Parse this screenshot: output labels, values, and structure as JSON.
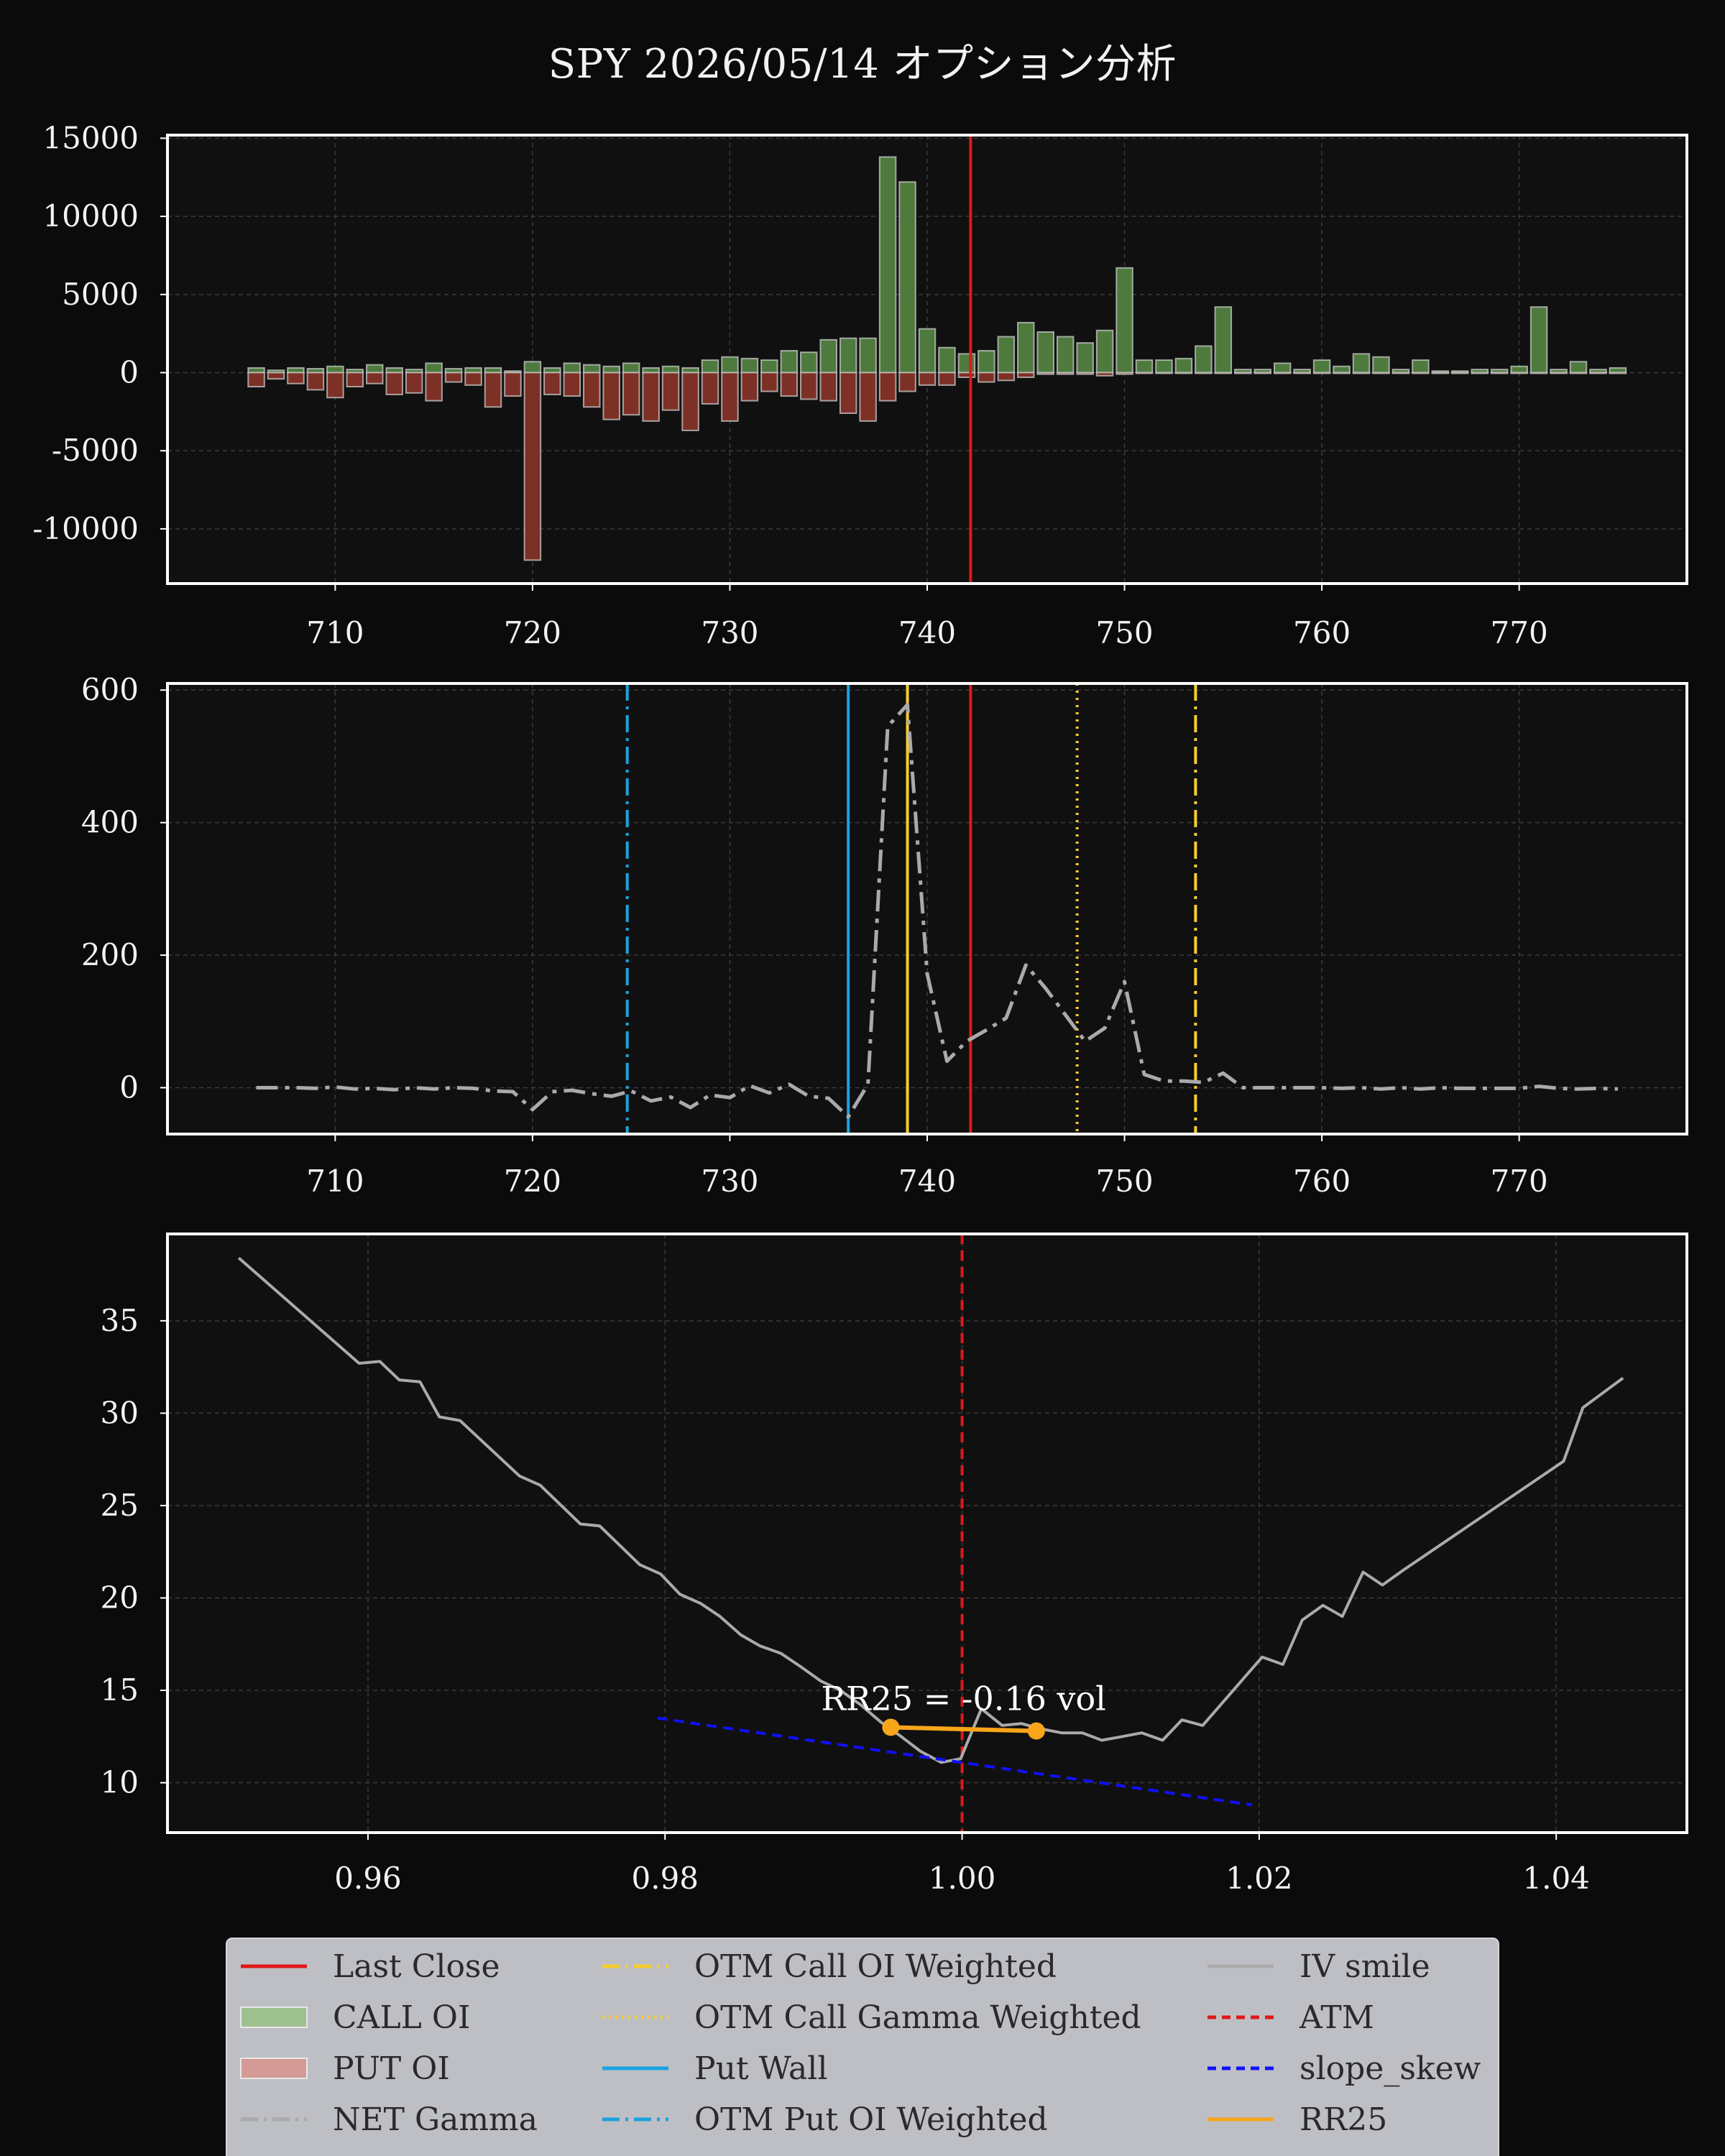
{
  "title": "SPY 2026/05/14 オプション分析",
  "colors": {
    "background": "#0b0b0b",
    "axes_bg": "#101010",
    "frame": "#ffffff",
    "grid": "#3a3a3a",
    "call": "#4e7a3e",
    "put": "#7d3026",
    "last_close": "#e01818",
    "gamma": "#aaaaaa",
    "otm_call": "#f7cd2e",
    "put_wall": "#1aa3e0",
    "iv_smile": "#aaaaaa",
    "slope_skew": "#1010ff",
    "rr25": "#f9a51a"
  },
  "chart_data": [
    {
      "type": "bar",
      "name": "oi-panel",
      "title": "",
      "xlabel": "",
      "ylabel": "",
      "xlim": [
        701.5,
        778.5
      ],
      "ylim": [
        -13500,
        15200
      ],
      "xticks": [
        710,
        720,
        730,
        740,
        750,
        760,
        770
      ],
      "yticks": [
        15000,
        10000,
        5000,
        0,
        -5000,
        -10000
      ],
      "grid": true,
      "last_close": 742.2,
      "strikes": [
        706,
        707,
        708,
        709,
        710,
        711,
        712,
        713,
        714,
        715,
        716,
        717,
        718,
        719,
        720,
        721,
        722,
        723,
        724,
        725,
        726,
        727,
        728,
        729,
        730,
        731,
        732,
        733,
        734,
        735,
        736,
        737,
        738,
        739,
        740,
        741,
        742,
        743,
        744,
        745,
        746,
        747,
        748,
        749,
        750,
        751,
        752,
        753,
        754,
        755,
        756,
        757,
        758,
        759,
        760,
        761,
        762,
        763,
        764,
        765,
        766,
        767,
        768,
        769,
        770,
        771,
        772,
        773,
        774,
        775
      ],
      "series": [
        {
          "name": "CALL OI",
          "values": [
            300,
            150,
            300,
            250,
            400,
            200,
            500,
            300,
            200,
            600,
            250,
            300,
            300,
            100,
            700,
            300,
            600,
            500,
            400,
            600,
            300,
            400,
            300,
            800,
            1000,
            900,
            800,
            1400,
            1300,
            2100,
            2200,
            2200,
            13800,
            12200,
            2800,
            1600,
            1200,
            1400,
            2300,
            3200,
            2600,
            2300,
            1900,
            2700,
            6700,
            800,
            800,
            900,
            1700,
            4200,
            200,
            200,
            600,
            200,
            800,
            400,
            1200,
            1000,
            200,
            800,
            100,
            100,
            200,
            200,
            400,
            4200,
            200,
            700,
            200,
            300
          ]
        },
        {
          "name": "PUT OI",
          "values": [
            -900,
            -400,
            -700,
            -1100,
            -1600,
            -900,
            -700,
            -1400,
            -1300,
            -1800,
            -600,
            -800,
            -2200,
            -1500,
            -12000,
            -1400,
            -1500,
            -2200,
            -3000,
            -2700,
            -3100,
            -2400,
            -3700,
            -2000,
            -3100,
            -1800,
            -1200,
            -1500,
            -1700,
            -1800,
            -2600,
            -3100,
            -1800,
            -1200,
            -800,
            -800,
            -300,
            -600,
            -500,
            -300,
            -100,
            -100,
            -100,
            -200,
            -100,
            -50,
            -50,
            -50,
            -50,
            -50,
            -50,
            -50,
            -50,
            -50,
            -50,
            -50,
            -50,
            -50,
            -50,
            -50,
            -50,
            -50,
            -50,
            -50,
            -50,
            -50,
            -50,
            -50,
            -50,
            -50
          ]
        }
      ]
    },
    {
      "type": "line",
      "name": "gamma-panel",
      "title": "",
      "xlabel": "",
      "ylabel": "",
      "xlim": [
        701.5,
        778.5
      ],
      "ylim": [
        -70,
        610
      ],
      "xticks": [
        710,
        720,
        730,
        740,
        750,
        760,
        770
      ],
      "yticks": [
        600,
        400,
        200,
        0
      ],
      "grid": true,
      "series": [
        {
          "name": "NET Gamma",
          "x": [
            706,
            707,
            708,
            709,
            710,
            711,
            712,
            713,
            714,
            715,
            716,
            717,
            718,
            719,
            720,
            721,
            722,
            723,
            724,
            725,
            726,
            727,
            728,
            729,
            730,
            731,
            732,
            733,
            734,
            735,
            736,
            737,
            738,
            739,
            740,
            741,
            742,
            743,
            744,
            745,
            746,
            747,
            748,
            749,
            750,
            751,
            752,
            753,
            754,
            755,
            756,
            757,
            758,
            759,
            760,
            761,
            762,
            763,
            764,
            765,
            766,
            767,
            768,
            769,
            770,
            771,
            772,
            773,
            774,
            775
          ],
          "y": [
            0,
            0,
            0,
            -1,
            1,
            -2,
            -1,
            -3,
            0,
            -2,
            0,
            -1,
            -5,
            -6,
            -33,
            -6,
            -4,
            -9,
            -13,
            -5,
            -20,
            -14,
            -30,
            -11,
            -15,
            3,
            -8,
            5,
            -13,
            -16,
            -44,
            5,
            545,
            578,
            172,
            40,
            70,
            87,
            105,
            185,
            150,
            110,
            70,
            90,
            160,
            20,
            10,
            10,
            8,
            22,
            0,
            0,
            0,
            0,
            0,
            -1,
            0,
            -2,
            0,
            -2,
            0,
            -1,
            -1,
            -1,
            -1,
            2,
            -1,
            -2,
            -1,
            -2
          ]
        }
      ],
      "vlines": [
        {
          "name": "Last Close",
          "x": 742.2
        },
        {
          "name": "OTM Call OI Weighted",
          "x": 753.6
        },
        {
          "name": "OTM Call Gamma Weighted",
          "x": 747.6
        },
        {
          "name": "Put Wall",
          "x": 736
        },
        {
          "name": "OTM Put OI Weighted",
          "x": 724.8
        },
        {
          "name": "",
          "x": 739
        }
      ]
    },
    {
      "type": "line",
      "name": "iv-panel",
      "title": "",
      "xlabel": "",
      "ylabel": "",
      "xlim": [
        0.9465,
        1.0488
      ],
      "ylim": [
        7.3,
        39.7
      ],
      "xticks": [
        0.96,
        0.98,
        1.0,
        1.02,
        1.04
      ],
      "xticklabels": [
        "0.96",
        "0.98",
        "1.00",
        "1.02",
        "1.04"
      ],
      "yticks": [
        35,
        30,
        25,
        20,
        15,
        10
      ],
      "grid": true,
      "atm": 1.0,
      "series": [
        {
          "name": "IV smile",
          "x": [
            0.9513,
            0.9594,
            0.9608,
            0.9621,
            0.9635,
            0.9648,
            0.9662,
            0.9702,
            0.9716,
            0.9743,
            0.9756,
            0.9783,
            0.9797,
            0.981,
            0.9824,
            0.9837,
            0.9851,
            0.9864,
            0.9878,
            0.9891,
            0.9905,
            0.9918,
            0.9932,
            0.9945,
            0.9959,
            0.9972,
            0.9986,
            0.9999,
            1.0013,
            1.0027,
            1.004,
            1.0054,
            1.0067,
            1.0081,
            1.0094,
            1.0108,
            1.0121,
            1.0135,
            1.0148,
            1.0162,
            1.0202,
            1.0216,
            1.0229,
            1.0243,
            1.0256,
            1.027,
            1.0283,
            1.0297,
            1.0405,
            1.0418,
            1.0445
          ],
          "y": [
            38.4,
            32.7,
            32.8,
            31.8,
            31.7,
            29.8,
            29.6,
            26.6,
            26.1,
            24.0,
            23.9,
            21.8,
            21.3,
            20.2,
            19.7,
            19.0,
            18.0,
            17.4,
            17.0,
            16.3,
            15.5,
            15.0,
            14.2,
            13.3,
            12.5,
            11.7,
            11.1,
            11.3,
            14.0,
            13.1,
            13.2,
            12.9,
            12.7,
            12.7,
            12.3,
            12.5,
            12.7,
            12.3,
            13.4,
            13.1,
            16.8,
            16.4,
            18.8,
            19.6,
            19.0,
            21.4,
            20.7,
            21.5,
            27.4,
            30.3,
            31.9
          ]
        },
        {
          "name": "slope_skew",
          "x": [
            0.9795,
            1.0195
          ],
          "y": [
            13.5,
            8.8
          ]
        },
        {
          "name": "RR25",
          "x": [
            0.9952,
            1.005
          ],
          "y": [
            13.0,
            12.8
          ]
        }
      ],
      "annotation": "RR25 = -0.16 vol"
    }
  ],
  "legend": {
    "placement": "bottom",
    "items": [
      {
        "label": "Last Close",
        "kind": "line",
        "color": "#e01818",
        "dash": ""
      },
      {
        "label": "CALL OI",
        "kind": "patch",
        "color": "#9ec08f"
      },
      {
        "label": "PUT OI",
        "kind": "patch",
        "color": "#d49a95"
      },
      {
        "label": "NET Gamma",
        "kind": "line",
        "color": "#aaaaaa",
        "dash": "24 8 4 8"
      },
      {
        "label": "OTM Call OI Weighted",
        "kind": "line",
        "color": "#f7cd2e",
        "dash": "24 8 4 8"
      },
      {
        "label": "OTM Call Gamma Weighted",
        "kind": "line",
        "color": "#f7cd2e",
        "dash": "3 6"
      },
      {
        "label": "Put Wall",
        "kind": "line",
        "color": "#1aa3e0",
        "dash": ""
      },
      {
        "label": "OTM Put OI Weighted",
        "kind": "line",
        "color": "#1aa3e0",
        "dash": "24 8 4 8"
      },
      {
        "label": "IV smile",
        "kind": "line",
        "color": "#aaaaaa",
        "dash": ""
      },
      {
        "label": "ATM",
        "kind": "line",
        "color": "#e01818",
        "dash": "12 8"
      },
      {
        "label": "slope_skew",
        "kind": "line",
        "color": "#1010ff",
        "dash": "12 8"
      },
      {
        "label": "RR25",
        "kind": "line",
        "color": "#f9a51a",
        "dash": ""
      }
    ]
  }
}
